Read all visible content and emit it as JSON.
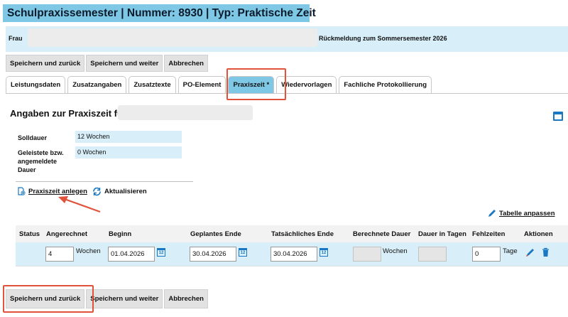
{
  "page": {
    "title": "Schulpraxissemester | Nummer: 8930 | Typ: Praktische Zeit"
  },
  "person": {
    "salutation": "Frau",
    "feedback": "Rückmeldung zum Sommersemester 2026"
  },
  "toolbar": {
    "save_back": "Speichern und zurück",
    "save_next": "Speichern und weiter",
    "cancel": "Abbrechen"
  },
  "tabs": [
    {
      "label": "Leistungsdaten"
    },
    {
      "label": "Zusatzangaben"
    },
    {
      "label": "Zusatztexte"
    },
    {
      "label": "PO-Element"
    },
    {
      "label": "Praxiszeit *"
    },
    {
      "label": "Wiedervorlagen"
    },
    {
      "label": "Fachliche Protokollierung"
    }
  ],
  "section": {
    "title": "Angaben zur Praxiszeit für"
  },
  "info": {
    "rows": [
      {
        "label": "Solldauer",
        "value": "12 Wochen"
      },
      {
        "label": "Geleistete bzw. angemeldete Dauer",
        "value": "0 Wochen"
      }
    ]
  },
  "actions": {
    "create": "Praxiszeit anlegen",
    "refresh": "Aktualisieren",
    "adjust_table": "Tabelle anpassen"
  },
  "table": {
    "headers": [
      "Status",
      "Angerechnet",
      "Beginn",
      "Geplantes Ende",
      "Tatsächliches Ende",
      "Berechnete Dauer",
      "Dauer in Tagen",
      "Fehlzeiten",
      "Aktionen"
    ],
    "row": {
      "credited": "4",
      "credited_unit": "Wochen",
      "begin": "01.04.2026",
      "planned_end": "30.04.2026",
      "actual_end": "30.04.2026",
      "calc_duration_unit": "Wochen",
      "absence": "0",
      "absence_unit": "Tage"
    },
    "cal_day": "12"
  },
  "colors": {
    "accent": "#7ec8e6",
    "light_accent": "#d8eef8",
    "highlight": "#e0533a",
    "icon_blue": "#1a78c2"
  }
}
